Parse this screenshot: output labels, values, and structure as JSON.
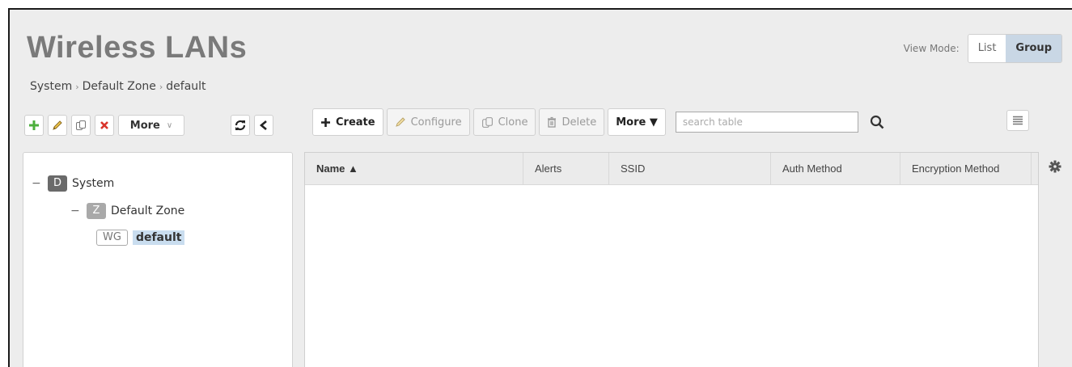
{
  "page": {
    "title": "Wireless LANs"
  },
  "breadcrumb": [
    "System",
    "Default Zone",
    "default"
  ],
  "view_mode": {
    "label": "View Mode:",
    "options": [
      "List",
      "Group"
    ],
    "selected": "Group"
  },
  "tree_toolbar": {
    "more_label": "More"
  },
  "grid_toolbar": {
    "create_label": "Create",
    "configure_label": "Configure",
    "clone_label": "Clone",
    "delete_label": "Delete",
    "more_label": "More ▼",
    "search_placeholder": "search table"
  },
  "tree": [
    {
      "badge": "D",
      "label": "System"
    },
    {
      "badge": "Z",
      "label": "Default Zone"
    },
    {
      "badge": "WG",
      "label": "default",
      "selected": true
    }
  ],
  "table": {
    "columns": [
      "Name ▲",
      "Alerts",
      "SSID",
      "Auth Method",
      "Encryption Method"
    ],
    "rows": []
  },
  "colors": {
    "accent": "#c9d7e5",
    "selected": "#c9ddef",
    "add": "#4caf3c",
    "delete": "#d9342b"
  },
  "icons": [
    "add-icon",
    "edit-icon",
    "clone-icon",
    "delete-icon",
    "refresh-icon",
    "collapse-icon",
    "search-icon",
    "menu-icon",
    "gear-icon"
  ]
}
